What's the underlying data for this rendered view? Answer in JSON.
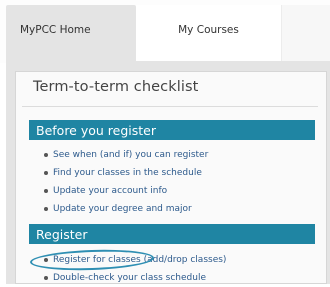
{
  "tabs": {
    "home": "MyPCC Home",
    "courses": "My Courses"
  },
  "checklist": {
    "title": "Term-to-term checklist",
    "sections": [
      {
        "header": "Before you register",
        "items": [
          "See when (and if) you can register",
          "Find your classes in the schedule",
          "Update your account info",
          "Update your degree and major"
        ]
      },
      {
        "header": "Register",
        "items": [
          "Register for classes (add/drop classes)",
          "Double-check your class schedule"
        ]
      }
    ]
  },
  "colors": {
    "section_header": "#1f85a3",
    "link": "#2d5a8c",
    "annotation_circle": "#2f8fb3"
  }
}
